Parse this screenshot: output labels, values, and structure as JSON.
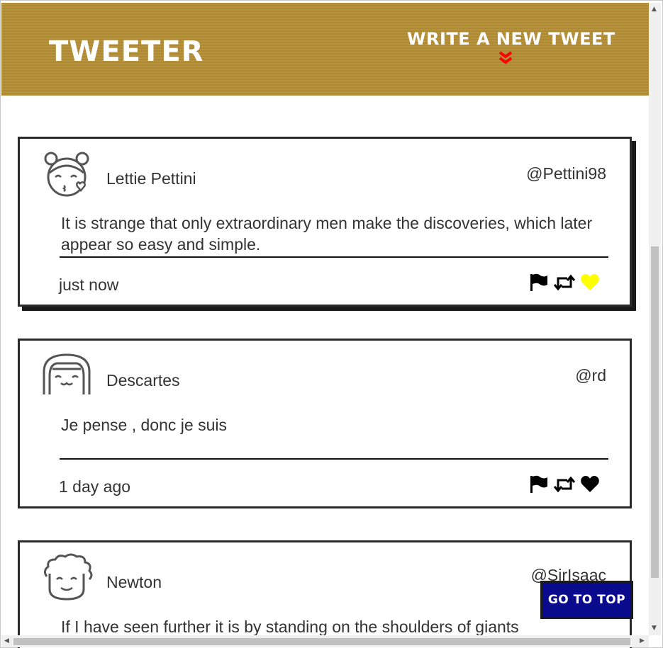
{
  "header": {
    "brand": "TWEETER",
    "compose_label": "WRITE A NEW TWEET"
  },
  "tweets": [
    {
      "name": "Lettie Pettini",
      "handle": "@Pettini98",
      "text": "It is strange that only extraordinary men make the discoveries, which later appear so easy and simple.",
      "time": "just now",
      "liked": true
    },
    {
      "name": "Descartes",
      "handle": "@rd",
      "text": "Je pense , donc je suis",
      "time": "1 day ago",
      "liked": false
    },
    {
      "name": "Newton",
      "handle": "@SirIsaac",
      "text": "If I have seen further it is by standing on the shoulders of giants",
      "time": "",
      "liked": false
    }
  ],
  "go_top_label": "GO TO TOP",
  "colors": {
    "header_bg": "#b58f36",
    "chevron": "#ff0000",
    "like_active": "#ffff00",
    "go_top_bg": "#0a0a8c"
  },
  "icons": [
    "flag-icon",
    "retweet-icon",
    "heart-icon",
    "double-chevron-down-icon"
  ]
}
